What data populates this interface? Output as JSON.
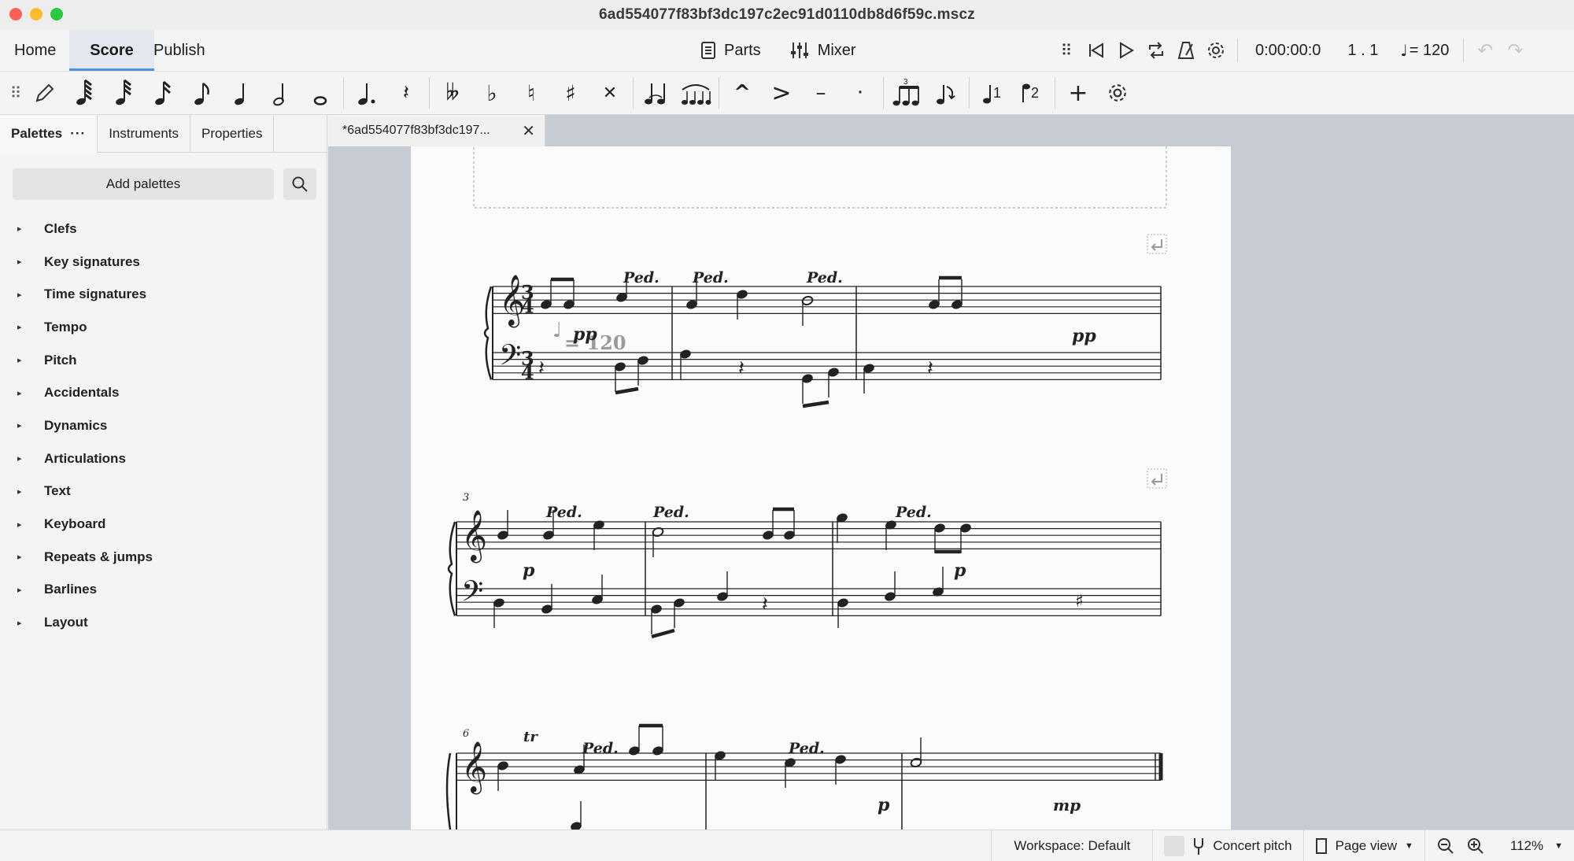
{
  "window": {
    "title": "6ad554077f83bf3dc197c2ec91d0110db8d6f59c.mscz"
  },
  "nav_tabs": [
    {
      "label": "Home"
    },
    {
      "label": "Score"
    },
    {
      "label": "Publish"
    }
  ],
  "toolbar": {
    "parts_label": "Parts",
    "mixer_label": "Mixer",
    "time": "0:00:00:0",
    "position": "1 . 1",
    "tempo": "= 120"
  },
  "palette_panel": {
    "tabs": [
      {
        "label": "Palettes"
      },
      {
        "label": "Instruments"
      },
      {
        "label": "Properties"
      }
    ],
    "add_palettes_label": "Add palettes",
    "items": [
      {
        "label": "Clefs"
      },
      {
        "label": "Key signatures"
      },
      {
        "label": "Time signatures"
      },
      {
        "label": "Tempo"
      },
      {
        "label": "Pitch"
      },
      {
        "label": "Accidentals"
      },
      {
        "label": "Dynamics"
      },
      {
        "label": "Articulations"
      },
      {
        "label": "Text"
      },
      {
        "label": "Keyboard"
      },
      {
        "label": "Repeats & jumps"
      },
      {
        "label": "Barlines"
      },
      {
        "label": "Layout"
      }
    ]
  },
  "document_tab": {
    "label": "*6ad554077f83bf3dc197..."
  },
  "score": {
    "tempo_marking": "= 120",
    "time_signature": [
      "3",
      "4"
    ],
    "measure_numbers": [
      "3",
      "6"
    ],
    "pedal_mark": "Ped.",
    "dynamics": {
      "pp": "pp",
      "p": "p",
      "mp": "mp"
    },
    "trill": "tr"
  },
  "status": {
    "workspace": "Workspace: Default",
    "concert_pitch": "Concert pitch",
    "view_mode": "Page view",
    "zoom": "112%"
  }
}
